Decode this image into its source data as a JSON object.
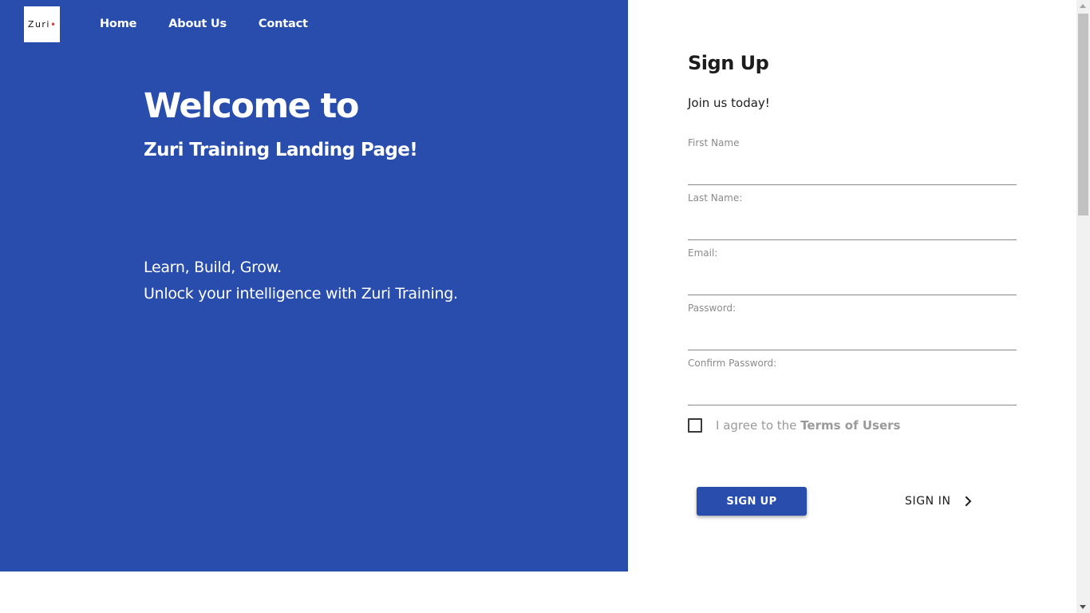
{
  "nav": {
    "logo_text": "Zuri",
    "logo_dot": "•",
    "items": [
      {
        "label": "Home"
      },
      {
        "label": "About Us"
      },
      {
        "label": "Contact"
      }
    ]
  },
  "hero": {
    "title": "Welcome to",
    "subtitle": "Zuri Training Landing Page!",
    "tagline_line1": "Learn, Build, Grow.",
    "tagline_line2": "Unlock your intelligence with Zuri Training."
  },
  "form": {
    "title": "Sign Up",
    "lead": "Join us today!",
    "fields": [
      {
        "label": "First Name",
        "value": ""
      },
      {
        "label": "Last Name:",
        "value": ""
      },
      {
        "label": "Email:",
        "value": ""
      },
      {
        "label": "Password:",
        "value": ""
      },
      {
        "label": "Confirm Password:",
        "value": ""
      }
    ],
    "agree_prefix": "I agree to the ",
    "terms_label": "Terms of Users",
    "agree_checked": false,
    "signup_label": "SIGN UP",
    "signin_label": "SIGN IN"
  },
  "colors": {
    "brand_blue": "#284dac",
    "logo_dot": "#e53935",
    "muted_text": "#9a9a9a"
  },
  "icons": {
    "signin_chevron": "chevron-right-icon"
  }
}
